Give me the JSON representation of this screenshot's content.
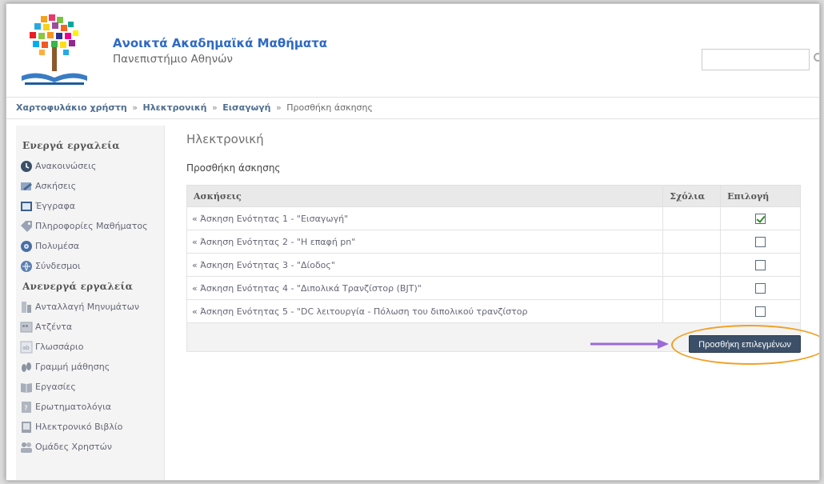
{
  "header": {
    "site_title": "Ανοικτά Ακαδημαϊκά Μαθήματα",
    "site_subtitle": "Πανεπιστήμιο Αθηνών",
    "search": {
      "value": "",
      "placeholder": ""
    }
  },
  "breadcrumb": [
    {
      "label": "Χαρτοφυλάκιο χρήστη",
      "link": true
    },
    {
      "label": "Ηλεκτρονική",
      "link": true
    },
    {
      "label": "Εισαγωγή",
      "link": true
    },
    {
      "label": "Προσθήκη άσκησης",
      "link": false
    }
  ],
  "breadcrumb_separator": "»",
  "sidebar": {
    "active_heading": "Ενεργά εργαλεία",
    "active_items": [
      {
        "label": "Ανακοινώσεις",
        "icon": "announcements-icon",
        "color": "#3b5068"
      },
      {
        "label": "Ασκήσεις",
        "icon": "exercises-icon",
        "color": "#6a85a6"
      },
      {
        "label": "Έγγραφα",
        "icon": "documents-icon",
        "color": "#3b5f8a"
      },
      {
        "label": "Πληροφορίες Μαθήματος",
        "icon": "course-info-icon",
        "color": "#8a93a6"
      },
      {
        "label": "Πολυμέσα",
        "icon": "multimedia-icon",
        "color": "#4a6fa5"
      },
      {
        "label": "Σύνδεσμοι",
        "icon": "links-icon",
        "color": "#5a7fb0"
      }
    ],
    "inactive_heading": "Ανενεργά εργαλεία",
    "inactive_items": [
      {
        "label": "Ανταλλαγή Μηνυμάτων",
        "icon": "messages-icon",
        "color": "#9aa2ad"
      },
      {
        "label": "Ατζέντα",
        "icon": "agenda-icon",
        "color": "#9aa2ad"
      },
      {
        "label": "Γλωσσάριο",
        "icon": "glossary-icon",
        "color": "#9aa2ad"
      },
      {
        "label": "Γραμμή μάθησης",
        "icon": "learning-path-icon",
        "color": "#9aa2ad"
      },
      {
        "label": "Εργασίες",
        "icon": "assignments-icon",
        "color": "#9aa2ad"
      },
      {
        "label": "Ερωτηματολόγια",
        "icon": "questionnaires-icon",
        "color": "#9aa2ad"
      },
      {
        "label": "Ηλεκτρονικό Βιβλίο",
        "icon": "ebook-icon",
        "color": "#9aa2ad"
      },
      {
        "label": "Ομάδες Χρηστών",
        "icon": "user-groups-icon",
        "color": "#9aa2ad"
      }
    ]
  },
  "main": {
    "course_title": "Ηλεκτρονική",
    "page_subtitle": "Προσθήκη άσκησης",
    "table": {
      "headers": [
        "Ασκήσεις",
        "Σχόλια",
        "Επιλογή"
      ],
      "rows": [
        {
          "title": "« Άσκηση Ενότητας 1 - \"Εισαγωγή\"",
          "comments": "",
          "selected": true
        },
        {
          "title": "« Άσκηση Ενότητας 2 - \"Η επαφή pn\"",
          "comments": "",
          "selected": false
        },
        {
          "title": "« Άσκηση Ενότητας 3 - \"Δίοδος\"",
          "comments": "",
          "selected": false
        },
        {
          "title": "« Άσκηση Ενότητας 4 - \"Διπολικά Τρανζίστορ (BJT)\"",
          "comments": "",
          "selected": false
        },
        {
          "title": "« Άσκηση Ενότητας 5 - \"DC λειτουργία - Πόλωση του διπολικού τρανζίστορ",
          "comments": "",
          "selected": false
        }
      ]
    },
    "add_selected_label": "Προσθήκη επιλεγμένων"
  },
  "annotation": {
    "arrow_color": "#9b6ad6",
    "ellipse_color": "#f0a126"
  },
  "colors": {
    "title_blue": "#2e6ac4",
    "button_bg": "#3b5068",
    "checkmark": "#2f8b2f"
  }
}
